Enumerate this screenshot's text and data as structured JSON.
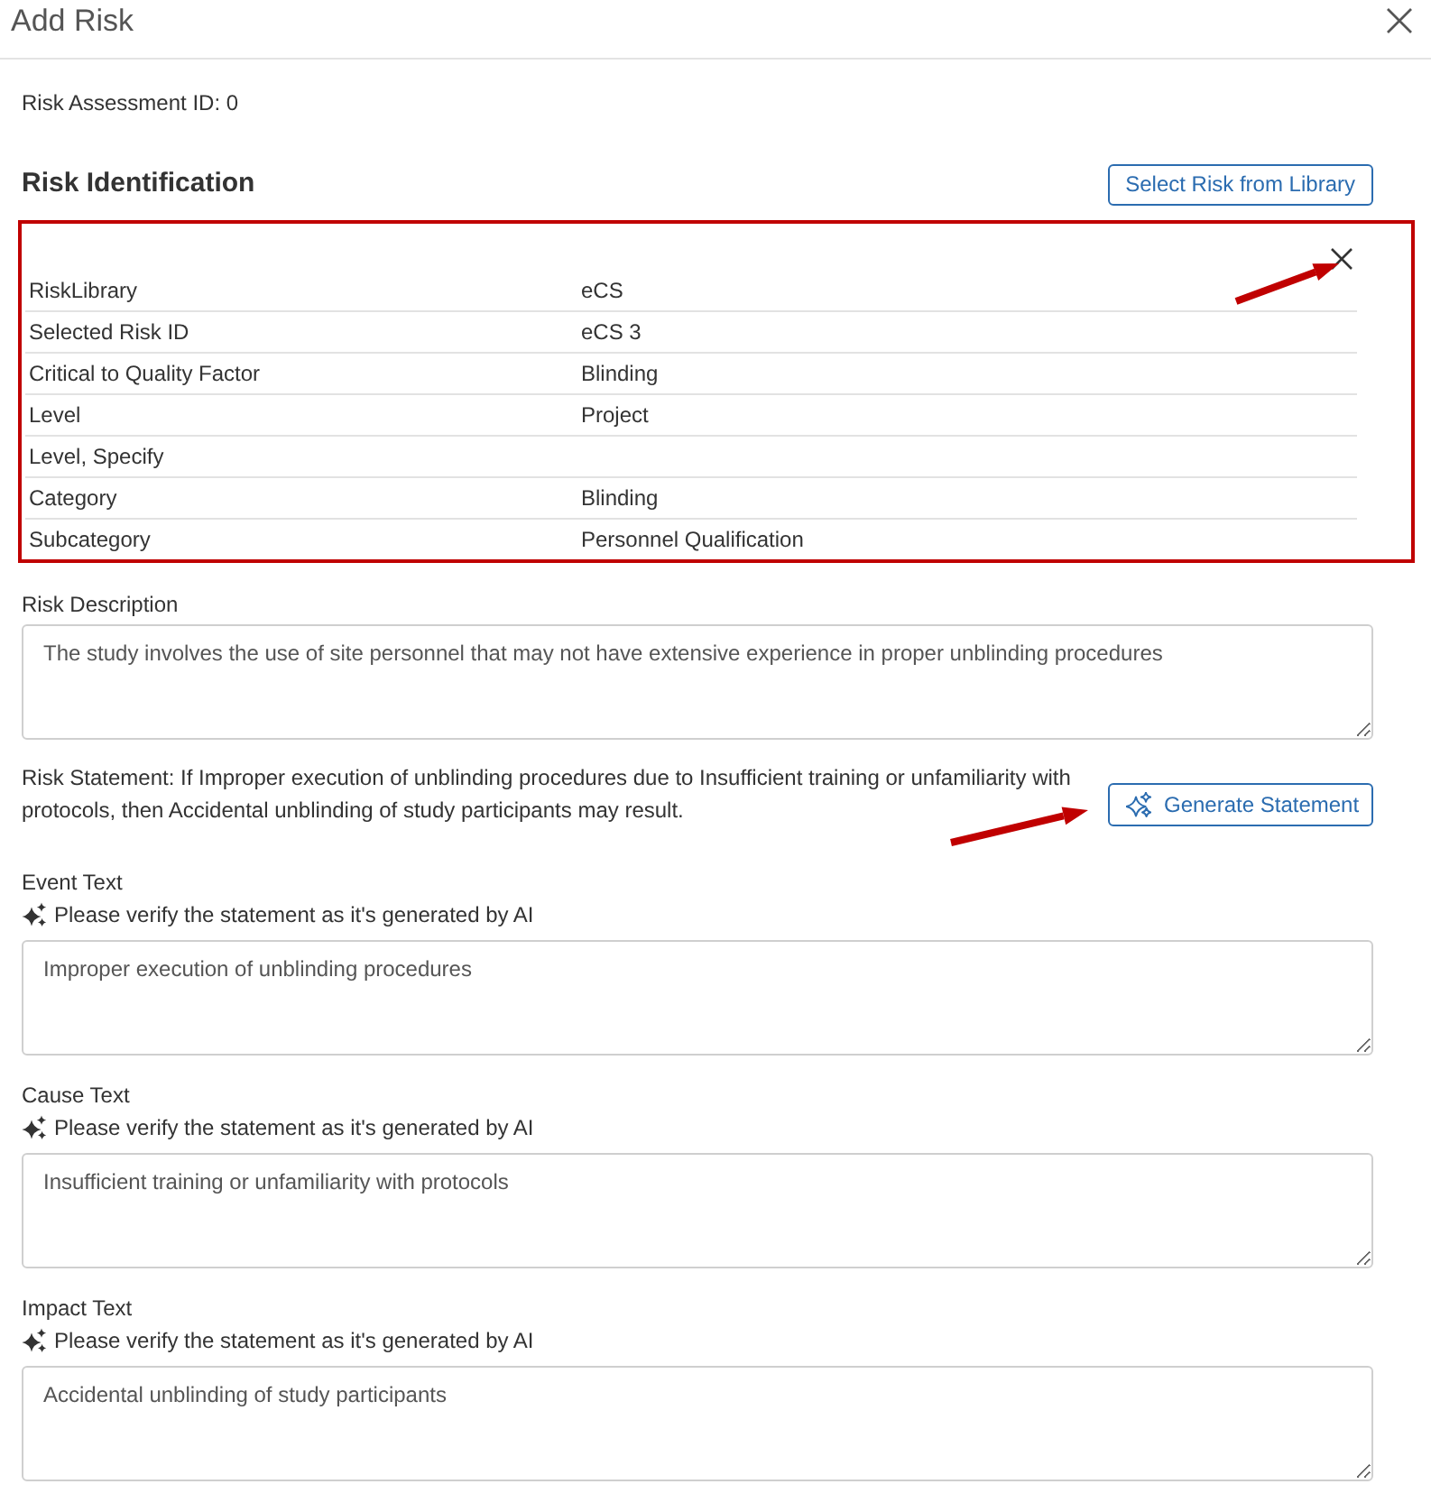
{
  "dialog": {
    "title": "Add Risk"
  },
  "assessment_id": "Risk Assessment ID: 0",
  "risk_identification": {
    "heading": "Risk Identification",
    "library_button": "Select Risk from Library",
    "rows": [
      {
        "label": "RiskLibrary",
        "value": "eCS"
      },
      {
        "label": "Selected Risk ID",
        "value": "eCS 3"
      },
      {
        "label": "Critical to Quality Factor",
        "value": "Blinding"
      },
      {
        "label": "Level",
        "value": "Project"
      },
      {
        "label": "Level, Specify"
      },
      {
        "label": "Category",
        "value": "Blinding"
      },
      {
        "label": "Subcategory",
        "value": "Personnel Qualification"
      }
    ]
  },
  "risk_description": {
    "label": "Risk Description",
    "value": "The study involves the use of site personnel that may not have extensive experience in proper unblinding procedures"
  },
  "risk_statement": "Risk Statement: If Improper execution of unblinding procedures due to Insufficient training or unfamiliarity with protocols, then Accidental unblinding of study participants may result.",
  "generate_button": "Generate Statement",
  "text_fields": [
    {
      "label": "Event Text",
      "note": "Please verify the statement as it's generated by AI",
      "value": "Improper execution of unblinding procedures"
    },
    {
      "label": "Cause Text",
      "note": "Please verify the statement as it's generated by AI",
      "value": "Insufficient training or unfamiliarity with protocols"
    },
    {
      "label": "Impact Text",
      "note": "Please verify the statement as it's generated by AI",
      "value": "Accidental unblinding of study participants"
    }
  ]
}
